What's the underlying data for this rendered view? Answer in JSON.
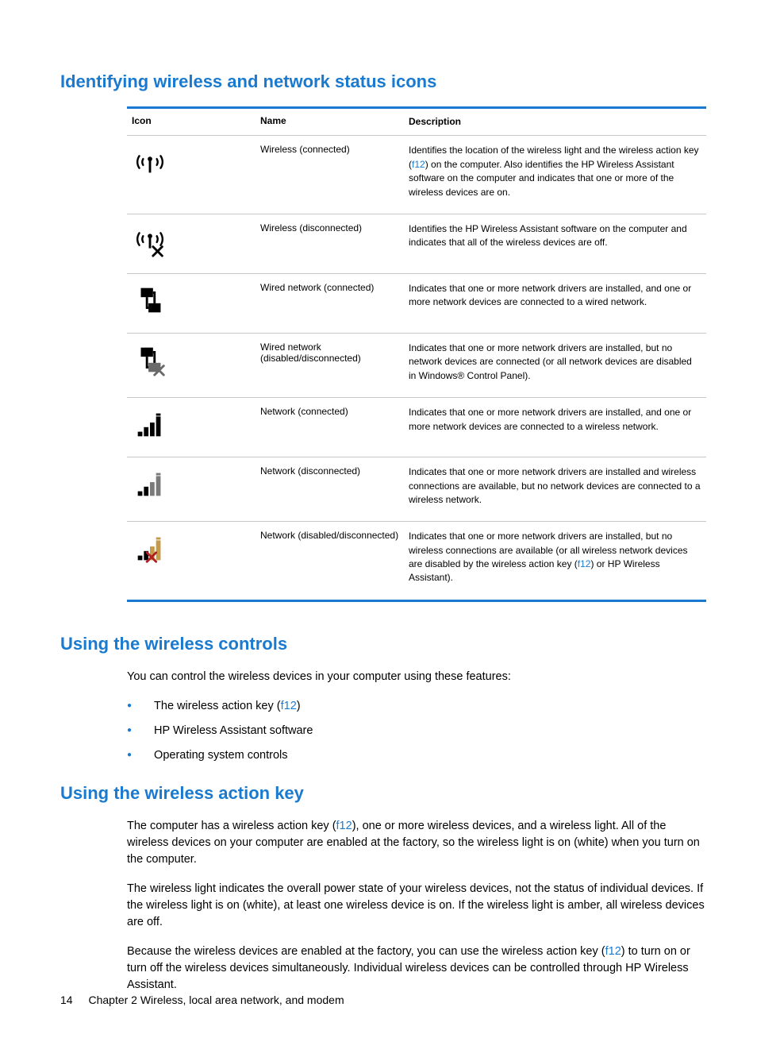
{
  "heading1": "Identifying wireless and network status icons",
  "table": {
    "headers": {
      "icon": "Icon",
      "name": "Name",
      "desc": "Description"
    },
    "rows": [
      {
        "icon": "wireless-connected-icon",
        "name": "Wireless (connected)",
        "desc_pre": "Identifies the location of the wireless light and the wireless action key (",
        "key": "f12",
        "desc_post": ") on the computer. Also identifies the HP Wireless Assistant software on the computer and indicates that one or more of the wireless devices are on."
      },
      {
        "icon": "wireless-disconnected-icon",
        "name": "Wireless (disconnected)",
        "desc_pre": "Identifies the HP Wireless Assistant software on the computer and indicates that all of the wireless devices are off.",
        "key": "",
        "desc_post": ""
      },
      {
        "icon": "wired-connected-icon",
        "name": "Wired network (connected)",
        "desc_pre": "Indicates that one or more network drivers are installed, and one or more network devices are connected to a wired network.",
        "key": "",
        "desc_post": ""
      },
      {
        "icon": "wired-disabled-icon",
        "name": "Wired network (disabled/disconnected)",
        "desc_pre": "Indicates that one or more network drivers are installed, but no network devices are connected (or all network devices are disabled in Windows® Control Panel).",
        "key": "",
        "desc_post": ""
      },
      {
        "icon": "network-connected-icon",
        "name": "Network (connected)",
        "desc_pre": "Indicates that one or more network drivers are installed, and one or more network devices are connected to a wireless network.",
        "key": "",
        "desc_post": ""
      },
      {
        "icon": "network-disconnected-icon",
        "name": "Network (disconnected)",
        "desc_pre": "Indicates that one or more network drivers are installed and wireless connections are available, but no network devices are connected to a wireless network.",
        "key": "",
        "desc_post": ""
      },
      {
        "icon": "network-disabled-icon",
        "name": "Network (disabled/disconnected)",
        "desc_pre": "Indicates that one or more network drivers are installed, but no wireless connections are available (or all wireless network devices are disabled by the wireless action key (",
        "key": "f12",
        "desc_post": ") or HP Wireless Assistant)."
      }
    ]
  },
  "heading2": "Using the wireless controls",
  "controls_intro": "You can control the wireless devices in your computer using these features:",
  "controls_items": {
    "a_pre": "The wireless action key (",
    "a_key": "f12",
    "a_post": ")",
    "b": "HP Wireless Assistant software",
    "c": "Operating system controls"
  },
  "heading3": "Using the wireless action key",
  "actionkey": {
    "p1_pre": "The computer has a wireless action key (",
    "p1_key": "f12",
    "p1_post": "), one or more wireless devices, and a wireless light. All of the wireless devices on your computer are enabled at the factory, so the wireless light is on (white) when you turn on the computer.",
    "p2": "The wireless light indicates the overall power state of your wireless devices, not the status of individual devices. If the wireless light is on (white), at least one wireless device is on. If the wireless light is amber, all wireless devices are off.",
    "p3_pre": "Because the wireless devices are enabled at the factory, you can use the wireless action key (",
    "p3_key": "f12",
    "p3_post": ") to turn on or turn off the wireless devices simultaneously. Individual wireless devices can be controlled through HP Wireless Assistant."
  },
  "footer": {
    "page": "14",
    "chapter": "Chapter 2   Wireless, local area network, and modem"
  }
}
